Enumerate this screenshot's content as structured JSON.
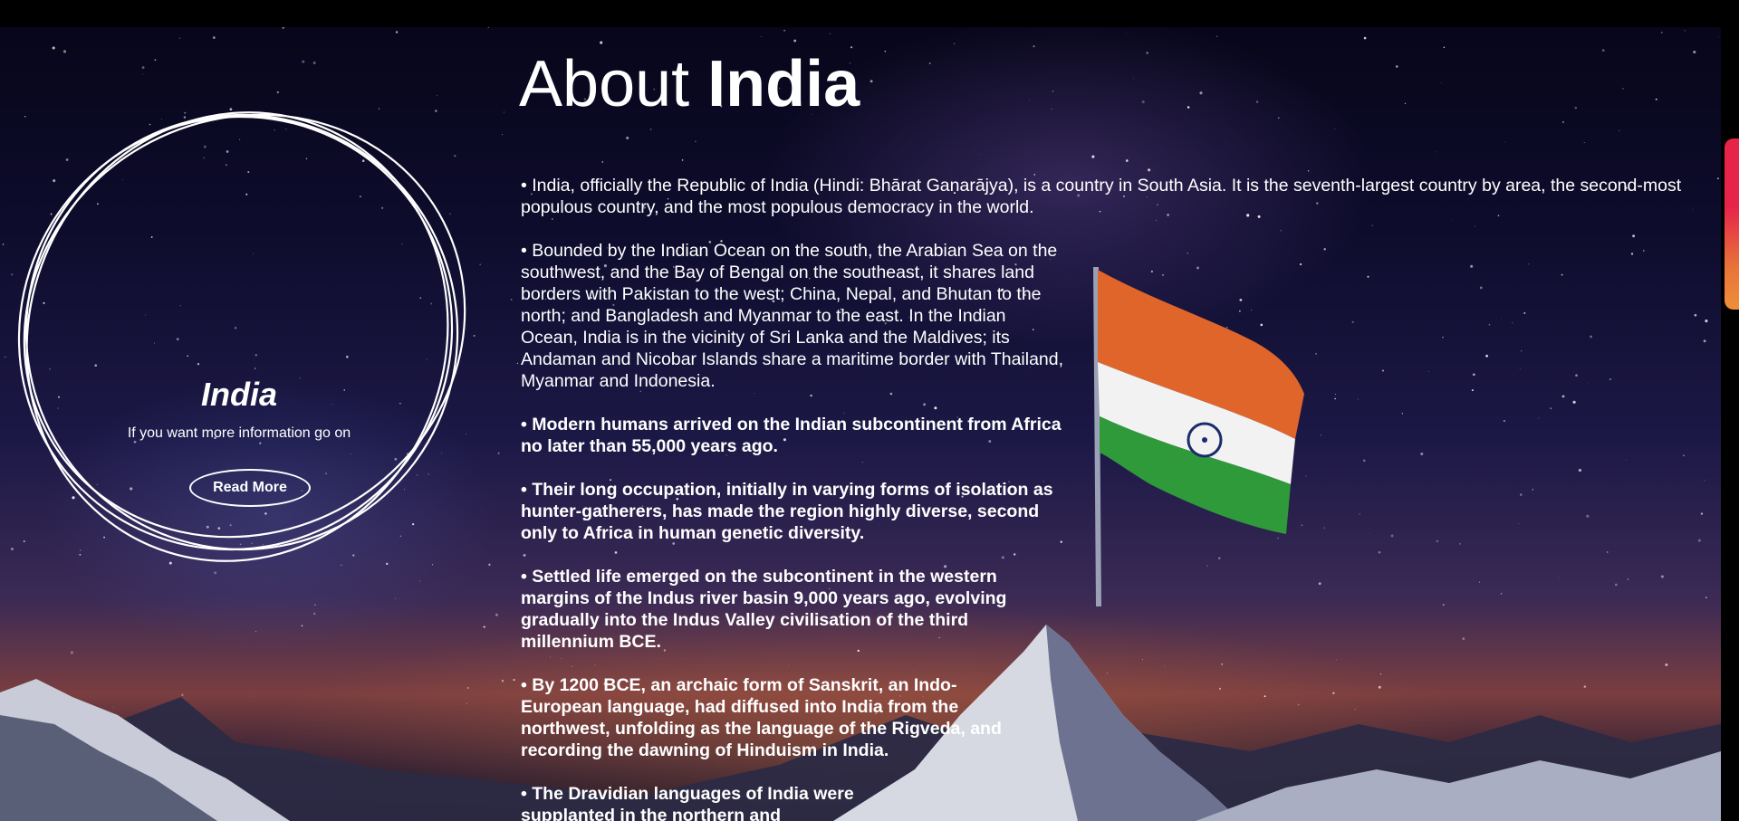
{
  "hero": {
    "title_light": "About",
    "title_bold": "India"
  },
  "card": {
    "title": "India",
    "subtitle": "If you want more information go on",
    "button_label": "Read More"
  },
  "paragraphs": [
    "• India, officially the Republic of India (Hindi: Bhārat Gaṇarājya), is a country in South Asia. It is the seventh-largest country by area, the second-most populous country, and the most populous democracy in the world.",
    "• Bounded by the Indian Ocean on the south, the Arabian Sea on the southwest, and the Bay of Bengal on the southeast, it shares land borders with Pakistan to the west; China, Nepal, and Bhutan to the north; and Bangladesh and Myanmar to the east. In the Indian Ocean, India is in the vicinity of Sri Lanka and the Maldives; its Andaman and Nicobar Islands share a maritime border with Thailand, Myanmar and Indonesia.",
    "• Modern humans arrived on the Indian subcontinent from Africa no later than 55,000 years ago.",
    "• Their long occupation, initially in varying forms of isolation as hunter-gatherers, has made the region highly diverse, second only to Africa in human genetic diversity.",
    "• Settled life emerged on the subcontinent in the western margins of the Indus river basin 9,000 years ago, evolving gradually into the Indus Valley civilisation of the third millennium BCE.",
    "• By 1200 BCE, an archaic form of Sanskrit, an Indo-European language, had diffused into India from the northwest, unfolding as the language of the Rigveda, and recording the dawning of Hinduism in India.",
    "• The Dravidian languages of India were supplanted in the northern and"
  ],
  "colors": {
    "flag_saffron": "#e0652a",
    "flag_white": "#f2f2f2",
    "flag_green": "#2f9a3a",
    "chakra_navy": "#1b2a6b",
    "scroll_thumb_top": "#e6244a",
    "scroll_thumb_bottom": "#ef8f3a"
  }
}
